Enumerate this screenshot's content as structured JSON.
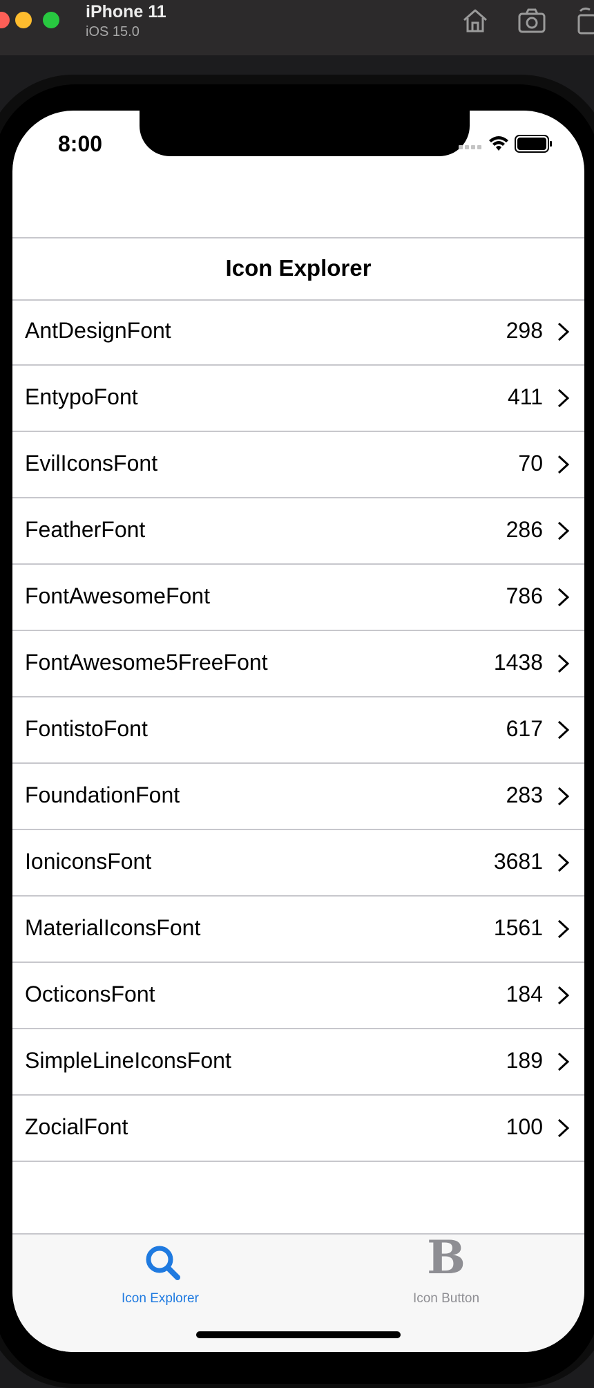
{
  "simulator": {
    "device_name": "iPhone 11",
    "os_version": "iOS 15.0",
    "toolbar_icons": [
      "home-icon",
      "camera-icon",
      "rotate-icon"
    ]
  },
  "status_bar": {
    "time": "8:00",
    "icons": [
      "signal-icon",
      "wifi-icon",
      "battery-icon"
    ]
  },
  "nav": {
    "title": "Icon Explorer"
  },
  "fonts": [
    {
      "name": "AntDesignFont",
      "count": "298"
    },
    {
      "name": "EntypoFont",
      "count": "411"
    },
    {
      "name": "EvilIconsFont",
      "count": "70"
    },
    {
      "name": "FeatherFont",
      "count": "286"
    },
    {
      "name": "FontAwesomeFont",
      "count": "786"
    },
    {
      "name": "FontAwesome5FreeFont",
      "count": "1438"
    },
    {
      "name": "FontistoFont",
      "count": "617"
    },
    {
      "name": "FoundationFont",
      "count": "283"
    },
    {
      "name": "IoniconsFont",
      "count": "3681"
    },
    {
      "name": "MaterialIconsFont",
      "count": "1561"
    },
    {
      "name": "OcticonsFont",
      "count": "184"
    },
    {
      "name": "SimpleLineIconsFont",
      "count": "189"
    },
    {
      "name": "ZocialFont",
      "count": "100"
    }
  ],
  "tabs": [
    {
      "label": "Icon Explorer",
      "icon": "search-icon",
      "active": true
    },
    {
      "label": "Icon Button",
      "icon": "b-glyph-icon",
      "glyph": "B",
      "active": false
    }
  ],
  "colors": {
    "accent": "#1f7ae0",
    "inactive": "#8e8e93",
    "separator": "#c7c7cc"
  }
}
